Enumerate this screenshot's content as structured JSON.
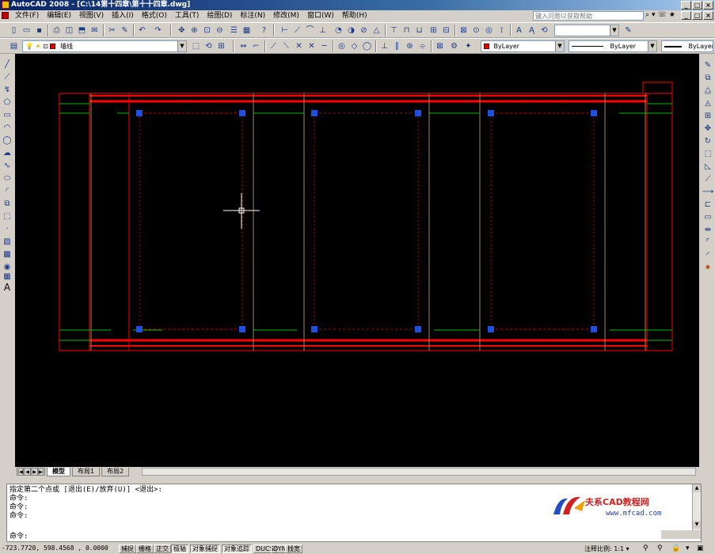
{
  "window": {
    "title": "AutoCAD 2008 - [C:\\14第十四章\\第十十四章.dwg]",
    "buttons": [
      "_",
      "□",
      "×"
    ]
  },
  "menu": {
    "items": [
      "文件(F)",
      "编辑(E)",
      "视图(V)",
      "插入(I)",
      "格式(O)",
      "工具(T)",
      "绘图(D)",
      "标注(N)",
      "修改(M)",
      "窗口(W)",
      "帮助(H)"
    ],
    "help_placeholder": "键入问题以获取帮助",
    "doc_buttons": [
      "_",
      "□",
      "×"
    ]
  },
  "toolbar": {
    "text_style_value": "",
    "layer_value": "墙线",
    "color_value": "ByLayer",
    "linetype_value": "ByLayer",
    "lineweight_value": "ByLayer"
  },
  "tabs": {
    "items": [
      "模型",
      "布局1",
      "布局2"
    ],
    "active": 0
  },
  "command": {
    "lines": [
      "指定第二个点或 [退出(E)/放弃(U)] <退出>:",
      "命令:",
      "命令:",
      "命令:"
    ],
    "prompt": "命令:"
  },
  "watermark": {
    "title": "夫系CAD教程网",
    "url": "www.mfcad.com"
  },
  "status": {
    "coordinates": "-723.7720,  598.4568 , 0.0000",
    "buttons": [
      "捕捉",
      "栅格",
      "正交",
      "极轴",
      "对象捕捉",
      "对象追踪",
      "DUCS",
      "DYN",
      "线宽"
    ],
    "buttons_on": [
      false,
      false,
      false,
      true,
      true,
      true,
      false,
      false,
      false
    ],
    "annotation_scale_label": "注释比例:",
    "annotation_scale_value": "1:1"
  },
  "colors": {
    "wall_line": "#ff0000",
    "axis_line": "#00c000",
    "column_grip": "#1f4fe0",
    "dashed_line": "#c00000",
    "crosshair": "#ffffff",
    "canvas_bg": "#000000",
    "column_line": "#a08a50"
  }
}
